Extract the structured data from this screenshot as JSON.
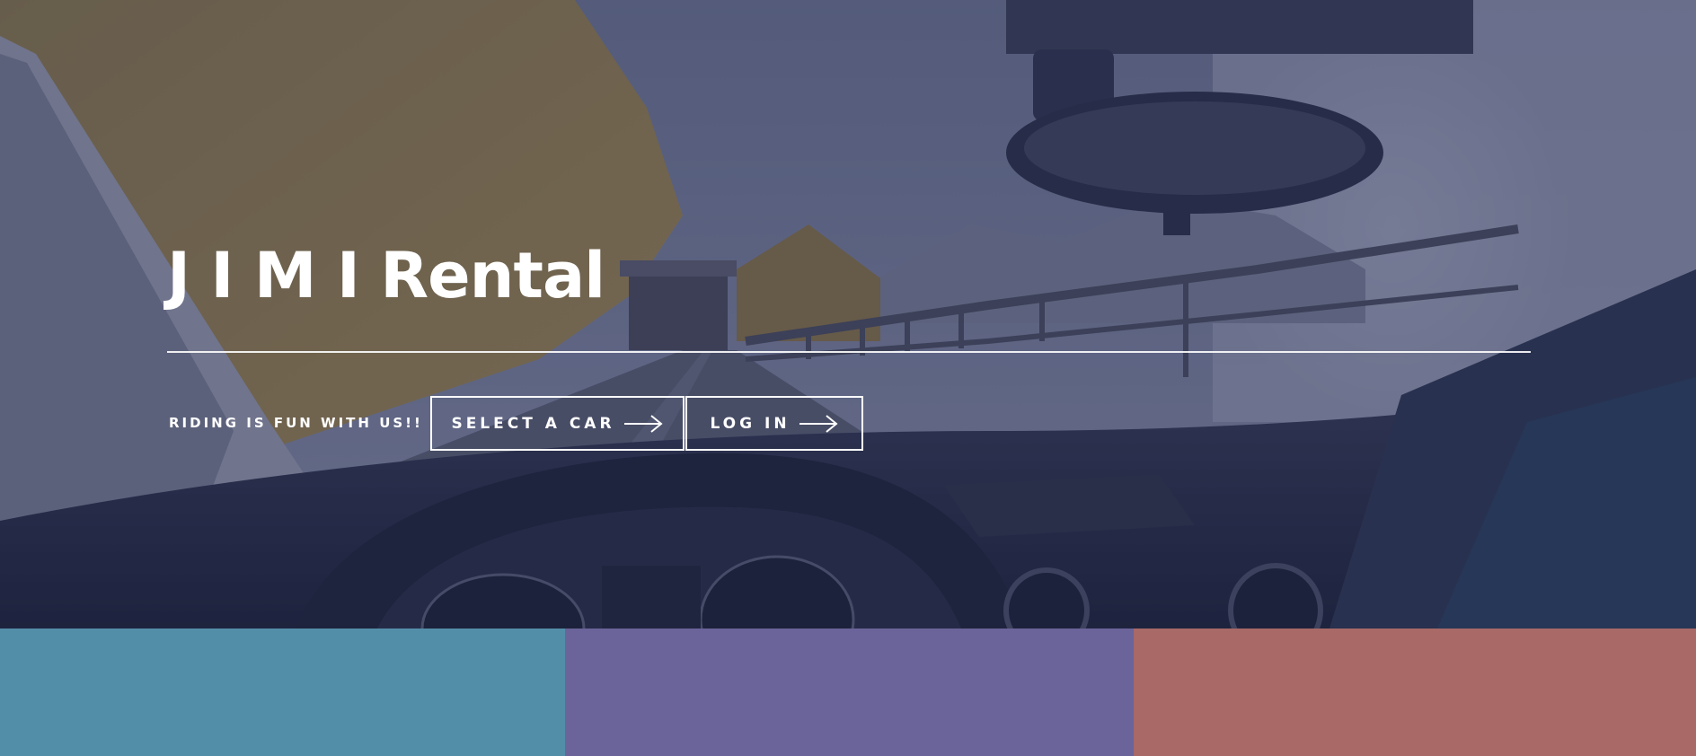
{
  "hero": {
    "title": "J I M I Rental",
    "tagline": "RIDING IS FUN WITH US!!",
    "buttons": {
      "select_car": {
        "label": "SELECT A CAR",
        "icon": "arrow-right-icon"
      },
      "log_in": {
        "label": "LOG IN",
        "icon": "arrow-right-icon"
      }
    },
    "background_image": "car-dashboard-mountain-road-photo"
  },
  "color_blocks": [
    {
      "color": "#538ea9"
    },
    {
      "color": "#6a649a"
    },
    {
      "color": "#a86967"
    }
  ]
}
